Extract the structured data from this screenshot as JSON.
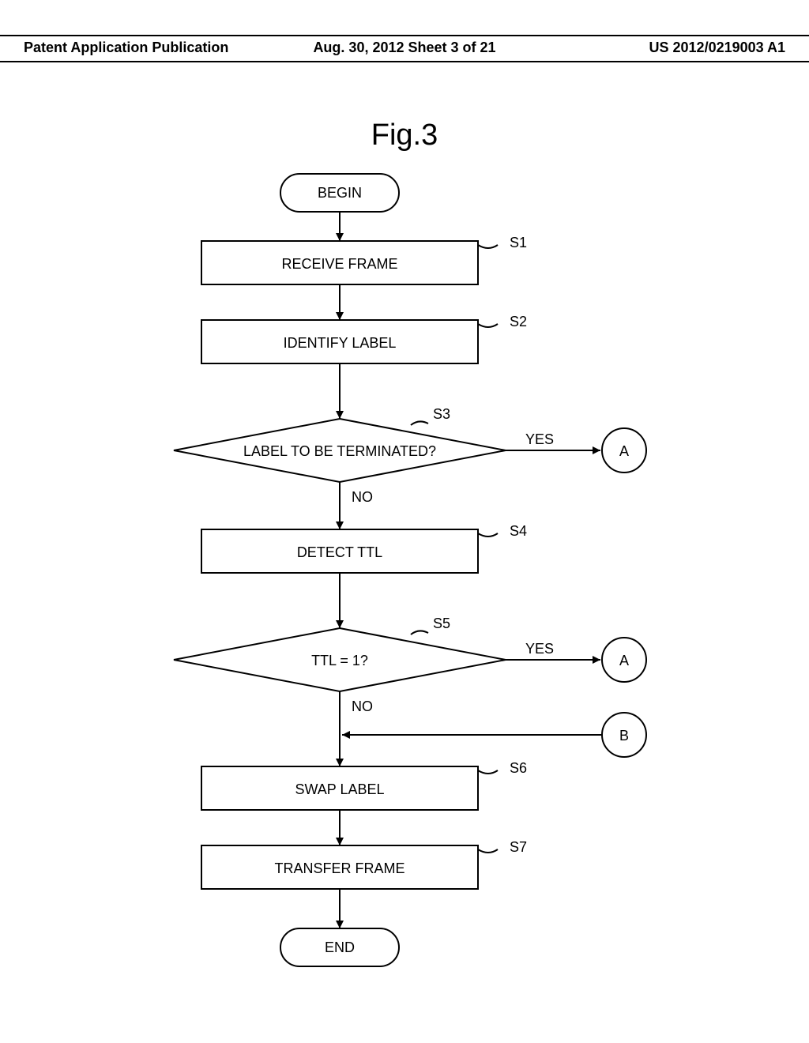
{
  "header": {
    "left": "Patent Application Publication",
    "mid": "Aug. 30, 2012  Sheet 3 of 21",
    "right": "US 2012/0219003 A1"
  },
  "figure_title": "Fig.3",
  "nodes": {
    "begin": "BEGIN",
    "s1": "RECEIVE FRAME",
    "s2": "IDENTIFY LABEL",
    "s3": "LABEL TO BE TERMINATED?",
    "s4": "DETECT TTL",
    "s5": "TTL = 1?",
    "s6": "SWAP LABEL",
    "s7": "TRANSFER FRAME",
    "end": "END"
  },
  "steps": {
    "s1": "S1",
    "s2": "S2",
    "s3": "S3",
    "s4": "S4",
    "s5": "S5",
    "s6": "S6",
    "s7": "S7"
  },
  "connectors": {
    "a1": "A",
    "a2": "A",
    "b": "B"
  },
  "edges": {
    "yes": "YES",
    "no": "NO"
  },
  "chart_data": {
    "type": "flowchart",
    "title": "Fig.3",
    "nodes": [
      {
        "id": "begin",
        "type": "terminator",
        "label": "BEGIN"
      },
      {
        "id": "s1",
        "type": "process",
        "label": "RECEIVE FRAME",
        "step": "S1"
      },
      {
        "id": "s2",
        "type": "process",
        "label": "IDENTIFY LABEL",
        "step": "S2"
      },
      {
        "id": "s3",
        "type": "decision",
        "label": "LABEL TO BE TERMINATED?",
        "step": "S3"
      },
      {
        "id": "s4",
        "type": "process",
        "label": "DETECT TTL",
        "step": "S4"
      },
      {
        "id": "s5",
        "type": "decision",
        "label": "TTL = 1?",
        "step": "S5"
      },
      {
        "id": "s6",
        "type": "process",
        "label": "SWAP LABEL",
        "step": "S6"
      },
      {
        "id": "s7",
        "type": "process",
        "label": "TRANSFER FRAME",
        "step": "S7"
      },
      {
        "id": "end",
        "type": "terminator",
        "label": "END"
      },
      {
        "id": "A1",
        "type": "offpage",
        "label": "A"
      },
      {
        "id": "A2",
        "type": "offpage",
        "label": "A"
      },
      {
        "id": "B",
        "type": "offpage",
        "label": "B"
      }
    ],
    "edges": [
      {
        "from": "begin",
        "to": "s1"
      },
      {
        "from": "s1",
        "to": "s2"
      },
      {
        "from": "s2",
        "to": "s3"
      },
      {
        "from": "s3",
        "to": "A1",
        "label": "YES"
      },
      {
        "from": "s3",
        "to": "s4",
        "label": "NO"
      },
      {
        "from": "s4",
        "to": "s5"
      },
      {
        "from": "s5",
        "to": "A2",
        "label": "YES"
      },
      {
        "from": "s5",
        "to": "s6",
        "label": "NO"
      },
      {
        "from": "B",
        "to": "s6"
      },
      {
        "from": "s6",
        "to": "s7"
      },
      {
        "from": "s7",
        "to": "end"
      }
    ]
  }
}
